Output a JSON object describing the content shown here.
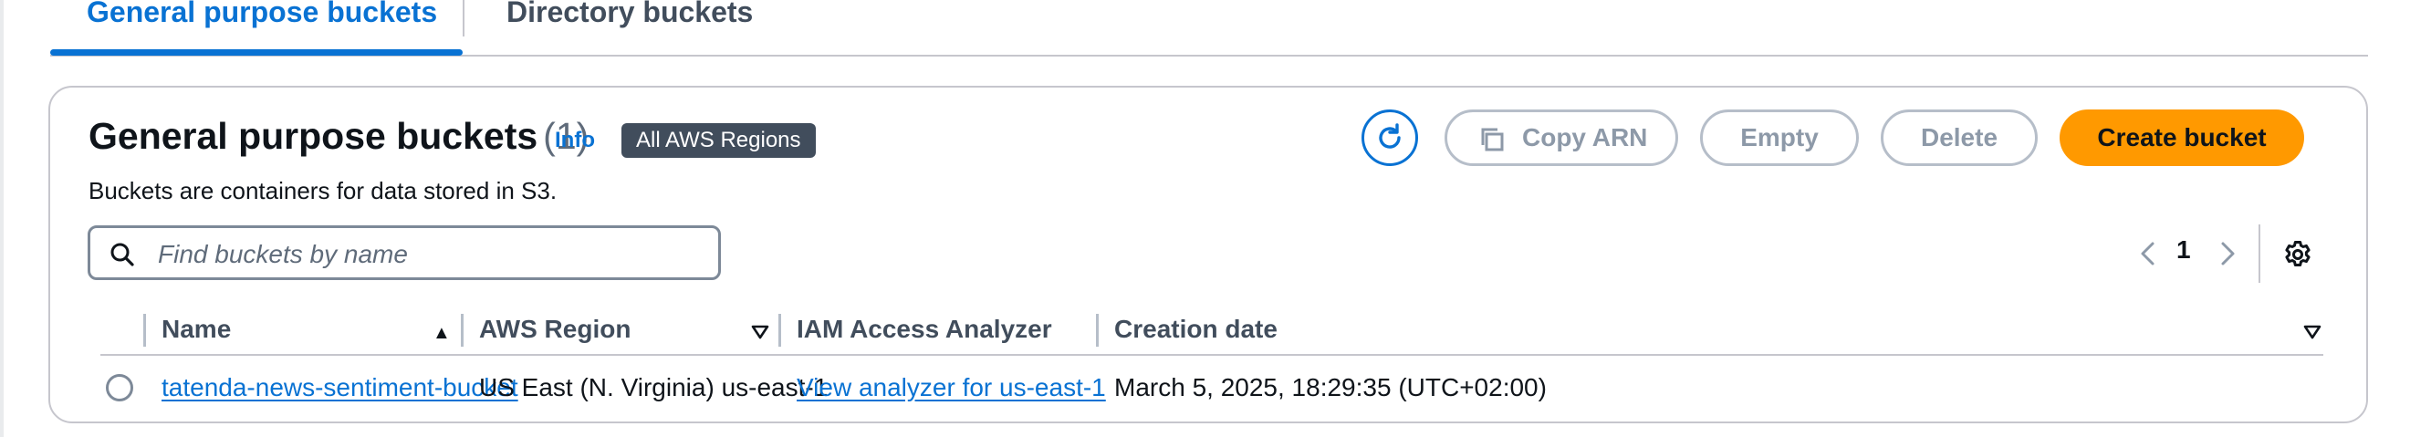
{
  "tabs": {
    "general": "General purpose buckets",
    "directory": "Directory buckets"
  },
  "header": {
    "title": "General purpose buckets",
    "count": "(1)",
    "info": "Info",
    "region_badge": "All AWS Regions",
    "description": "Buckets are containers for data stored in S3."
  },
  "actions": {
    "copy_arn": "Copy ARN",
    "empty": "Empty",
    "delete": "Delete",
    "create": "Create bucket"
  },
  "search": {
    "placeholder": "Find buckets by name",
    "value": ""
  },
  "pagination": {
    "current_page": "1"
  },
  "table": {
    "columns": [
      "Name",
      "AWS Region",
      "IAM Access Analyzer",
      "Creation date"
    ],
    "rows": [
      {
        "name": "tatenda-news-sentiment-bucket",
        "region": "US East (N. Virginia) us-east-1",
        "access_analyzer": "View analyzer for us-east-1",
        "creation_date": "March 5, 2025, 18:29:35 (UTC+02:00)"
      }
    ]
  },
  "icons": {
    "refresh": "refresh-icon",
    "copy": "copy-icon",
    "search": "search-icon",
    "prev": "chevron-left-icon",
    "next": "chevron-right-icon",
    "settings": "gear-icon",
    "sort_asc": "sort-ascending-icon",
    "sort_desc": "sort-descending-icon"
  },
  "colors": {
    "link": "#0972d3",
    "primary_button": "#ff9900",
    "badge": "#414d5c",
    "disabled": "#8d99a8"
  }
}
